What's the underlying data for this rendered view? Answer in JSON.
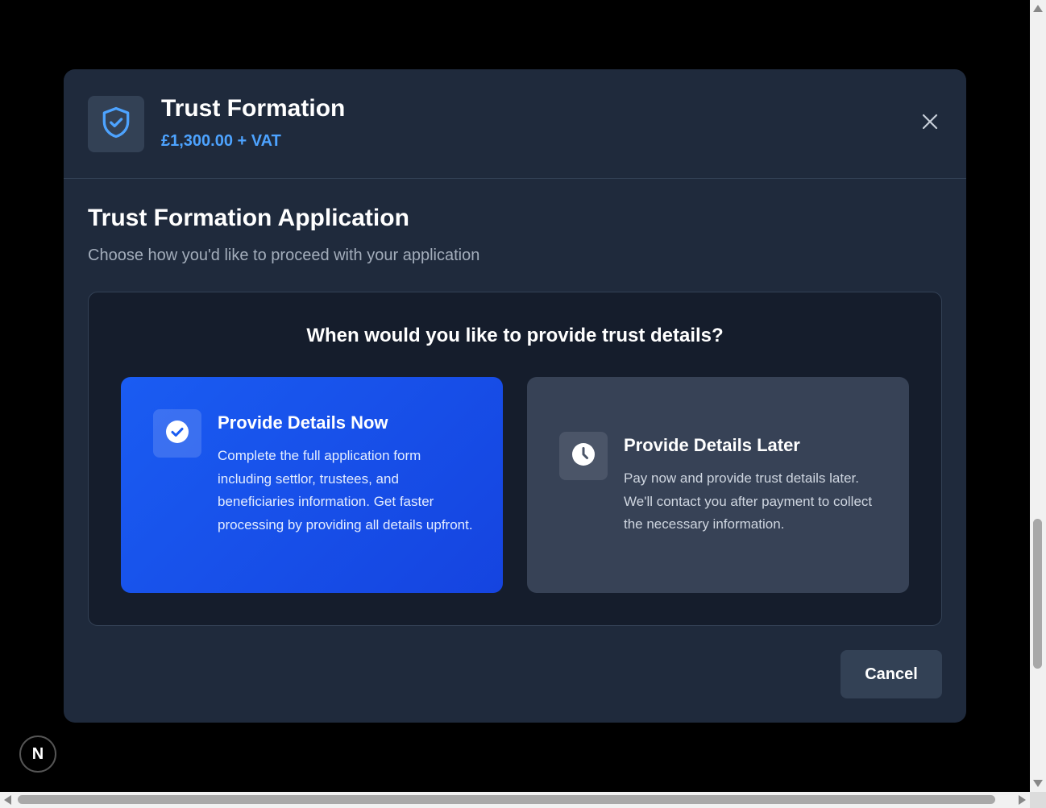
{
  "modal": {
    "header": {
      "icon": "shield-check-icon",
      "title": "Trust Formation",
      "price": "£1,300.00 + VAT",
      "close_icon": "close-icon"
    },
    "section": {
      "title": "Trust Formation Application",
      "subtitle": "Choose how you'd like to proceed with your application"
    },
    "options": {
      "question": "When would you like to provide trust details?",
      "items": [
        {
          "icon": "check-circle-icon",
          "title": "Provide Details Now",
          "description": "Complete the full application form including settlor, trustees, and beneficiaries information. Get faster processing by providing all details upfront.",
          "selected": true
        },
        {
          "icon": "clock-icon",
          "title": "Provide Details Later",
          "description": "Pay now and provide trust details later. We'll contact you after payment to collect the necessary information.",
          "selected": false
        }
      ]
    },
    "footer": {
      "cancel_label": "Cancel"
    }
  },
  "dev_badge": {
    "label": "N"
  },
  "colors": {
    "page_background": "#000000",
    "modal_background": "#1f2a3c",
    "accent_price": "#4da3ff",
    "selected_card": "#1a5cf2",
    "unselected_card": "#374256"
  }
}
